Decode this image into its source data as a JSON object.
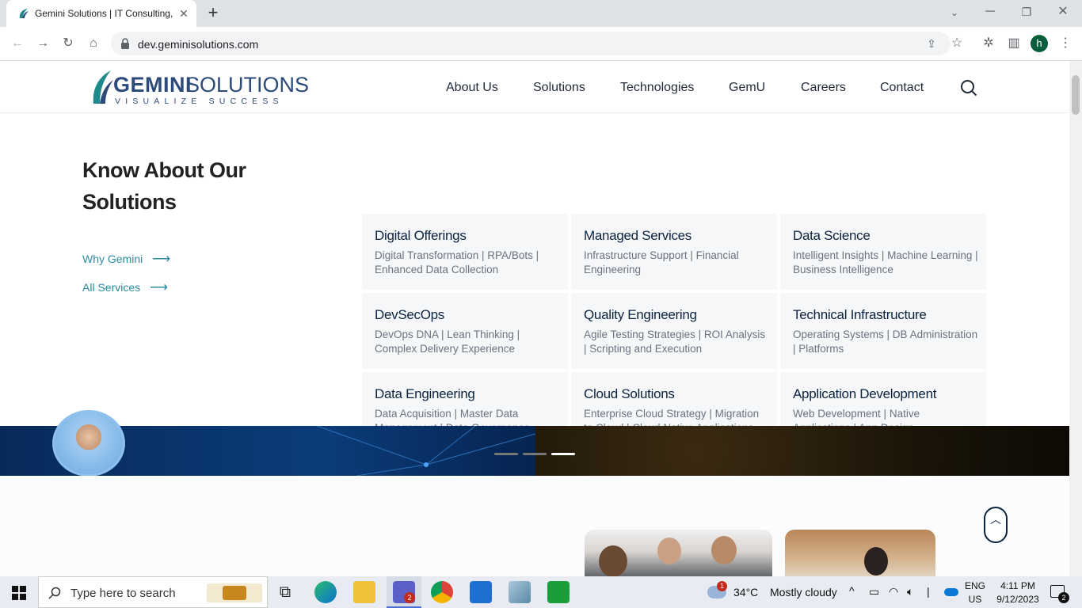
{
  "browser": {
    "tab_title": "Gemini Solutions | IT Consulting,",
    "url": "dev.geminisolutions.com",
    "profile_initial": "h"
  },
  "site": {
    "logo_main": "GEMINI",
    "logo_sub": "SOLUTIONS",
    "logo_tagline": "VISUALIZE SUCCESS",
    "nav": [
      "About Us",
      "Solutions",
      "Technologies",
      "GemU",
      "Careers",
      "Contact"
    ]
  },
  "mega_menu": {
    "title": "Know About Our Solutions",
    "links": [
      "Why Gemini",
      "All Services"
    ],
    "cards": [
      {
        "title": "Digital Offerings",
        "desc": "Digital Transformation | RPA/Bots | Enhanced Data Collection"
      },
      {
        "title": "Managed Services",
        "desc": "Infrastructure Support | Financial Engineering"
      },
      {
        "title": "Data Science",
        "desc": "Intelligent Insights | Machine Learning | Business Intelligence"
      },
      {
        "title": "DevSecOps",
        "desc": "DevOps DNA | Lean Thinking | Complex Delivery Experience"
      },
      {
        "title": "Quality Engineering",
        "desc": "Agile Testing Strategies | ROI Analysis | Scripting and Execution"
      },
      {
        "title": "Technical Infrastructure",
        "desc": "Operating Systems | DB Administration | Platforms"
      },
      {
        "title": "Data Engineering",
        "desc": "Data Acquisition | Master Data Management | Data Governance"
      },
      {
        "title": "Cloud Solutions",
        "desc": "Enterprise Cloud Strategy | Migration to Cloud | Cloud Native Applications"
      },
      {
        "title": "Application Development",
        "desc": "Web Development | Native Applications | App Design"
      }
    ]
  },
  "carousel": {
    "slide_count": 3,
    "active_index": 2
  },
  "taskbar": {
    "search_placeholder": "Type here to search",
    "weather_temp": "34°C",
    "weather_text": "Mostly cloudy",
    "weather_badge": "1",
    "teams_badge": "2",
    "lang_line1": "ENG",
    "lang_line2": "US",
    "time": "4:11 PM",
    "date": "9/12/2023",
    "notification_count": "2"
  },
  "colors": {
    "accent_teal": "#2a8ba0",
    "navy": "#0c2340",
    "logo_teal": "#1f8a8a"
  }
}
